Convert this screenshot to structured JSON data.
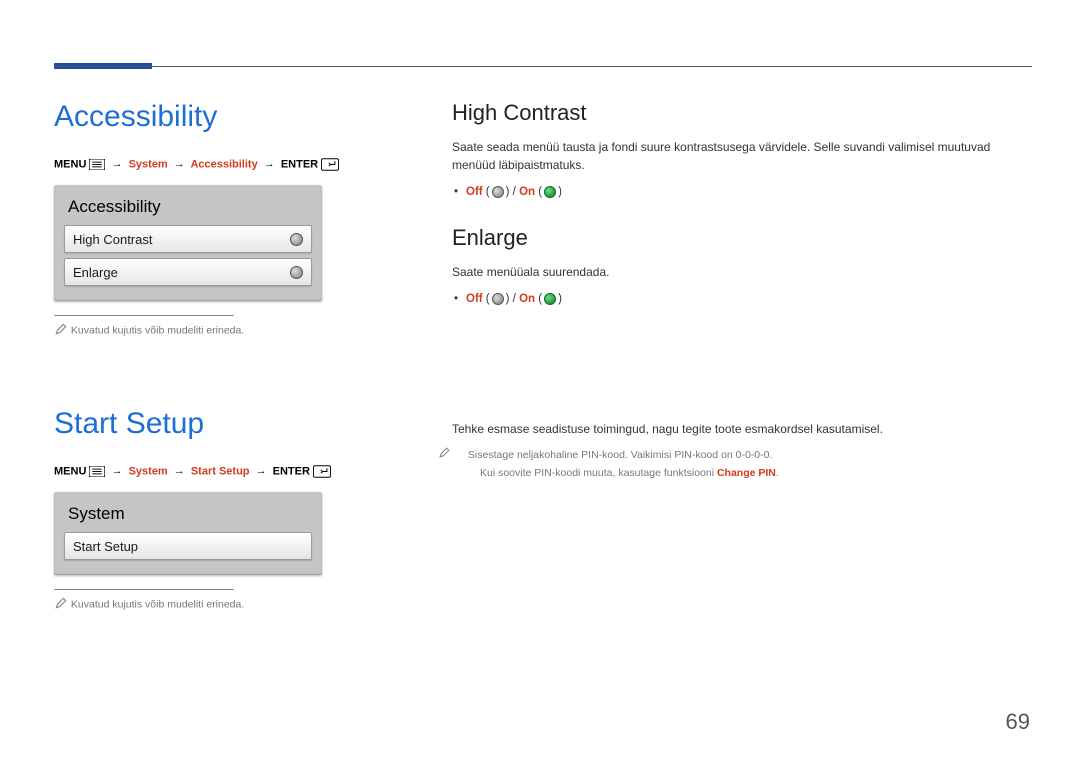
{
  "page_number": "69",
  "left": {
    "section1": {
      "title": "Accessibility",
      "breadcrumb": {
        "menu": "MENU",
        "p1": "System",
        "p2": "Accessibility",
        "enter": "ENTER"
      },
      "panel": {
        "title": "Accessibility",
        "rows": [
          {
            "label": "High Contrast",
            "state": "off"
          },
          {
            "label": "Enlarge",
            "state": "off"
          }
        ]
      },
      "note": "Kuvatud kujutis võib mudeliti erineda."
    },
    "section2": {
      "title": "Start Setup",
      "breadcrumb": {
        "menu": "MENU",
        "p1": "System",
        "p2": "Start Setup",
        "enter": "ENTER"
      },
      "panel": {
        "title": "System",
        "rows": [
          {
            "label": "Start Setup"
          }
        ]
      },
      "note": "Kuvatud kujutis võib mudeliti erineda."
    }
  },
  "right": {
    "high_contrast": {
      "heading": "High Contrast",
      "desc": "Saate seada menüü tausta ja fondi suure kontrastsusega värvidele. Selle suvandi valimisel muutuvad menüüd läbipaistmatuks.",
      "off": "Off",
      "on": "On"
    },
    "enlarge": {
      "heading": "Enlarge",
      "desc": "Saate menüüala suurendada.",
      "off": "Off",
      "on": "On"
    },
    "start_setup": {
      "desc": "Tehke esmase seadistuse toimingud, nagu tegite toote esmakordsel kasutamisel.",
      "note1a": "Sisestage neljakohaline PIN-kood. Vaikimisi PIN-kood on 0-0-0-0.",
      "note1b_pre": "Kui soovite PIN-koodi muuta, kasutage funktsiooni ",
      "note1b_red": "Change PIN",
      "note1b_post": "."
    }
  }
}
